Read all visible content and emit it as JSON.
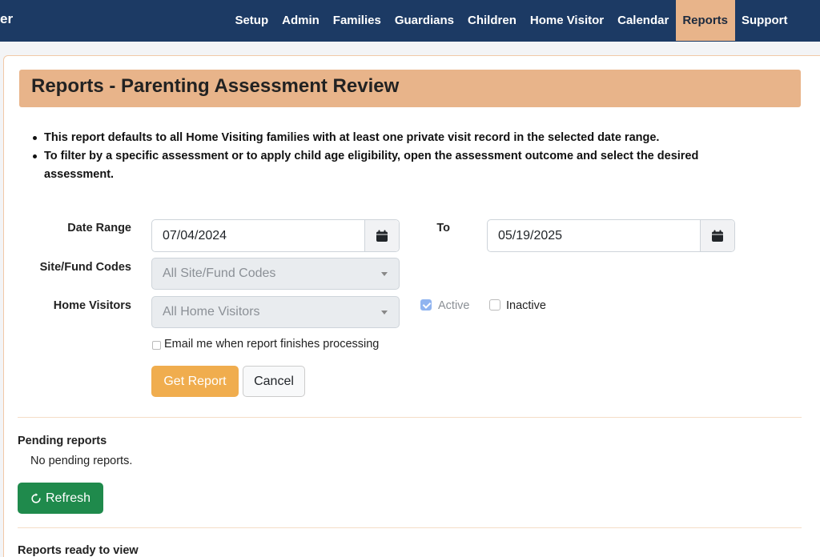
{
  "navbar": {
    "brand_fragment": "er",
    "items": [
      {
        "label": "Setup"
      },
      {
        "label": "Admin"
      },
      {
        "label": "Families"
      },
      {
        "label": "Guardians"
      },
      {
        "label": "Children"
      },
      {
        "label": "Home Visitor"
      },
      {
        "label": "Calendar"
      },
      {
        "label": "Reports",
        "active": true
      },
      {
        "label": "Support"
      }
    ],
    "bg_color": "#1c3a64",
    "active_color": "#e8b48a"
  },
  "page": {
    "title": "Reports - Parenting Assessment Review",
    "notes": [
      "This report defaults to all Home Visiting families with at least one private visit record in the selected date range.",
      "To filter by a specific assessment or to apply child age eligibility, open the assessment outcome and select the desired assessment."
    ]
  },
  "form": {
    "date_range_label": "Date Range",
    "start_date": "07/04/2024",
    "to_label": "To",
    "end_date": "05/19/2025",
    "site_fund_label": "Site/Fund Codes",
    "site_fund_value": "All Site/Fund Codes",
    "home_visitors_label": "Home Visitors",
    "home_visitors_value": "All Home Visitors",
    "active_label": "Active",
    "active_checked": true,
    "inactive_label": "Inactive",
    "inactive_checked": false,
    "email_label": "Email me when report finishes processing",
    "email_checked": false,
    "get_report_label": "Get Report",
    "cancel_label": "Cancel"
  },
  "pending": {
    "title": "Pending reports",
    "empty_text": "No pending reports.",
    "refresh_label": "Refresh"
  },
  "ready": {
    "title": "Reports ready to view"
  },
  "icons": {
    "calendar": "calendar-icon",
    "refresh": "refresh-icon",
    "caret": "chevron-down-icon"
  }
}
